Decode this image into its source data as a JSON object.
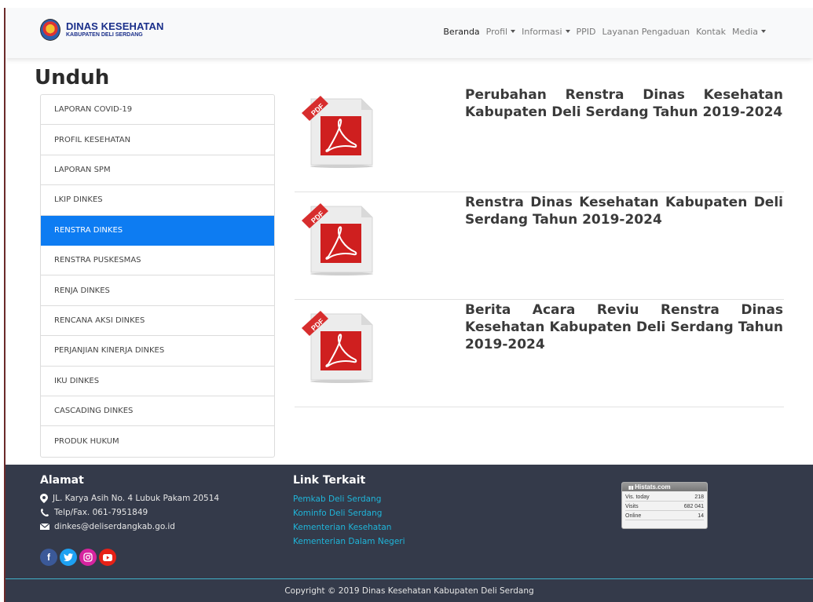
{
  "brand": {
    "title": "DINAS KESEHATAN",
    "subtitle": "KABUPATEN DELI SERDANG"
  },
  "nav": {
    "items": [
      {
        "label": "Beranda",
        "active": true,
        "dropdown": false
      },
      {
        "label": "Profil",
        "dropdown": true
      },
      {
        "label": "Informasi",
        "dropdown": true
      },
      {
        "label": "PPID",
        "dropdown": false
      },
      {
        "label": "Layanan Pengaduan",
        "dropdown": false
      },
      {
        "label": "Kontak",
        "dropdown": false
      },
      {
        "label": "Media",
        "dropdown": true
      }
    ]
  },
  "page": {
    "title": "Unduh"
  },
  "sidebar": {
    "items": [
      {
        "label": "LAPORAN COVID-19"
      },
      {
        "label": "PROFIL KESEHATAN"
      },
      {
        "label": "LAPORAN SPM"
      },
      {
        "label": "LKIP DINKES"
      },
      {
        "label": "RENSTRA DINKES",
        "active": true
      },
      {
        "label": "RENSTRA PUSKESMAS"
      },
      {
        "label": "RENJA DINKES"
      },
      {
        "label": "RENCANA AKSI DINKES"
      },
      {
        "label": "PERJANJIAN KINERJA DINKES"
      },
      {
        "label": "IKU DINKES"
      },
      {
        "label": "CASCADING DINKES"
      },
      {
        "label": "PRODUK HUKUM"
      }
    ]
  },
  "downloads": [
    {
      "title": "Perubahan Renstra Dinas Kesehatan Kabupaten Deli Serdang Tahun 2019-2024",
      "icon": "pdf-icon",
      "badge": "PDF"
    },
    {
      "title": "Renstra Dinas Kesehatan Kabupaten Deli Serdang Tahun 2019-2024",
      "icon": "pdf-icon",
      "badge": "PDF"
    },
    {
      "title": "Berita Acara Reviu Renstra Dinas Kesehatan Kabupaten Deli Serdang Tahun 2019-2024",
      "icon": "pdf-icon",
      "badge": "PDF"
    }
  ],
  "footer": {
    "address": {
      "title": "Alamat",
      "street": "JL. Karya Asih No. 4 Lubuk Pakam 20514",
      "phone": "Telp/Fax. 061-7951849",
      "email": "dinkes@deliserdangkab.go.id"
    },
    "links": {
      "title": "Link Terkait",
      "items": [
        "Pemkab Deli Serdang",
        "Kominfo Deli Serdang",
        "Kementerian Kesehatan",
        "Kementerian Dalam Negeri"
      ]
    },
    "social": [
      {
        "icon": "facebook-icon",
        "color": "#3b5998",
        "glyph": "f"
      },
      {
        "icon": "twitter-icon",
        "color": "#1da1f2",
        "glyph": ""
      },
      {
        "icon": "instagram-icon",
        "color": "#d6249f",
        "glyph": ""
      },
      {
        "icon": "youtube-icon",
        "color": "#e62117",
        "glyph": ""
      }
    ],
    "histats": {
      "brand": "Histats.com",
      "rows": [
        {
          "label": "Vis. today",
          "value": "218"
        },
        {
          "label": "Visits",
          "value": "682 041"
        },
        {
          "label": "Online",
          "value": "14"
        }
      ]
    },
    "copyright": "Copyright © 2019 Dinas Kesehatan Kabupaten Deli Serdang"
  },
  "colors": {
    "accent": "#0d7cf2",
    "footer_bg": "#343a4a",
    "link": "#1fb5d9",
    "brand": "#1a2f8a"
  }
}
